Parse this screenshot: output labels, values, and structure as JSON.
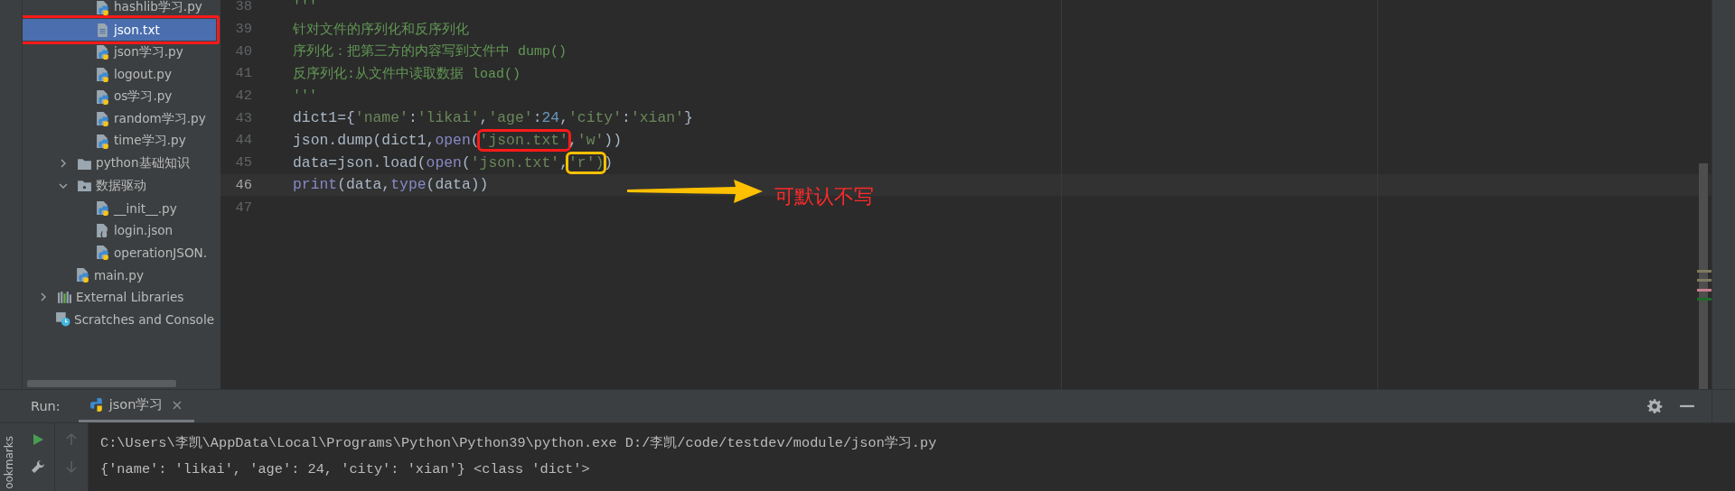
{
  "project_tree": [
    {
      "children": [
        {
          "children": [
            {
              "label": "hashlib学习.py",
              "kind": "py",
              "selected": false
            },
            {
              "label": "json.txt",
              "kind": "txt",
              "selected": true,
              "color": "#ff1a1a"
            },
            {
              "label": "json学习.py",
              "kind": "py",
              "selected": false
            },
            {
              "label": "logout.py",
              "kind": "py",
              "selected": false
            },
            {
              "label": "os学习.py",
              "kind": "py",
              "selected": false
            },
            {
              "label": "random学习.py",
              "kind": "py",
              "selected": false
            },
            {
              "label": "time学习.py",
              "kind": "py",
              "selected": false
            }
          ]
        },
        {
          "label": "python基础知识",
          "kind": "folder",
          "expanded": false,
          "selected": false
        },
        {
          "label": "数据驱动",
          "kind": "package",
          "expanded": true,
          "selected": false,
          "children": [
            {
              "label": "__init__.py",
              "kind": "py",
              "selected": false
            },
            {
              "label": "login.json",
              "kind": "json",
              "selected": false
            },
            {
              "label": "operationJSON.",
              "kind": "py",
              "selected": false
            }
          ]
        },
        {
          "label": "main.py",
          "kind": "py",
          "selected": false
        }
      ]
    },
    {
      "label": "External Libraries",
      "kind": "libraries",
      "expanded": false,
      "selected": false
    },
    {
      "label": "Scratches and Console",
      "kind": "scratches",
      "selected": false
    }
  ],
  "editor": {
    "lines": [
      {
        "number": "38",
        "current": false,
        "tokens": [
          {
            "text": "'''",
            "kind": "comment"
          }
        ]
      },
      {
        "number": "39",
        "current": false,
        "tokens": [
          {
            "text": "针对文件的序列化和反序列化",
            "kind": "comment"
          }
        ]
      },
      {
        "number": "40",
        "current": false,
        "tokens": [
          {
            "text": "序列化：把第三方的内容写到文件中 dump()",
            "kind": "comment"
          }
        ]
      },
      {
        "number": "41",
        "current": false,
        "tokens": [
          {
            "text": "反序列化:从文件中读取数据 load()",
            "kind": "comment"
          }
        ]
      },
      {
        "number": "42",
        "current": false,
        "tokens": [
          {
            "text": "'''",
            "kind": "comment"
          }
        ]
      },
      {
        "number": "43",
        "current": false,
        "tokens": [
          {
            "text": "dict1={",
            "kind": "plain"
          },
          {
            "text": "'name'",
            "kind": "string"
          },
          {
            "text": ":",
            "kind": "plain"
          },
          {
            "text": "'likai'",
            "kind": "string"
          },
          {
            "text": ",",
            "kind": "plain"
          },
          {
            "text": "'age'",
            "kind": "string"
          },
          {
            "text": ":",
            "kind": "plain"
          },
          {
            "text": "24",
            "kind": "number"
          },
          {
            "text": ",",
            "kind": "plain"
          },
          {
            "text": "'city'",
            "kind": "string"
          },
          {
            "text": ":",
            "kind": "plain"
          },
          {
            "text": "'xian'",
            "kind": "string"
          },
          {
            "text": "}",
            "kind": "plain"
          }
        ]
      },
      {
        "number": "44",
        "current": false,
        "tokens": [
          {
            "text": "json.dump(dict1,",
            "kind": "plain"
          },
          {
            "text": "open",
            "kind": "builtin"
          },
          {
            "text": "(",
            "kind": "plain"
          },
          {
            "text": "'json.txt'",
            "kind": "string",
            "color": "#ff1a1a"
          },
          {
            "text": ",",
            "kind": "plain"
          },
          {
            "text": "'w'",
            "kind": "string"
          },
          {
            "text": "))",
            "kind": "plain"
          }
        ]
      },
      {
        "number": "45",
        "current": false,
        "tokens": [
          {
            "text": "data=json.load(",
            "kind": "plain"
          },
          {
            "text": "open",
            "kind": "builtin"
          },
          {
            "text": "(",
            "kind": "plain"
          },
          {
            "text": "'json.txt'",
            "kind": "string"
          },
          {
            "text": ",",
            "kind": "plain"
          },
          {
            "text": "'r')",
            "kind": "string",
            "color": "#ffc000"
          },
          {
            "text": ")",
            "kind": "plain"
          }
        ]
      },
      {
        "number": "46",
        "current": true,
        "tokens": [
          {
            "text": "print",
            "kind": "builtin"
          },
          {
            "text": "(data,",
            "kind": "plain"
          },
          {
            "text": "type",
            "kind": "builtin"
          },
          {
            "text": "(data))",
            "kind": "plain"
          }
        ]
      },
      {
        "number": "47",
        "current": false
      }
    ],
    "callout": {
      "text": "可默认不写",
      "color": "#ff2a2a"
    }
  },
  "run_panel": {
    "label": "Run:",
    "tabs": [
      {
        "label": "json学习",
        "close": "×",
        "selected": true
      }
    ],
    "output": [
      "C:\\Users\\李凯\\AppData\\Local\\Programs\\Python\\Python39\\python.exe D:/李凯/code/testdev/module/json学习.py",
      "{'name': 'likai', 'age': 24, 'city': 'xian'} <class 'dict'>"
    ]
  },
  "side_strip": {
    "label": "ookmarks"
  }
}
